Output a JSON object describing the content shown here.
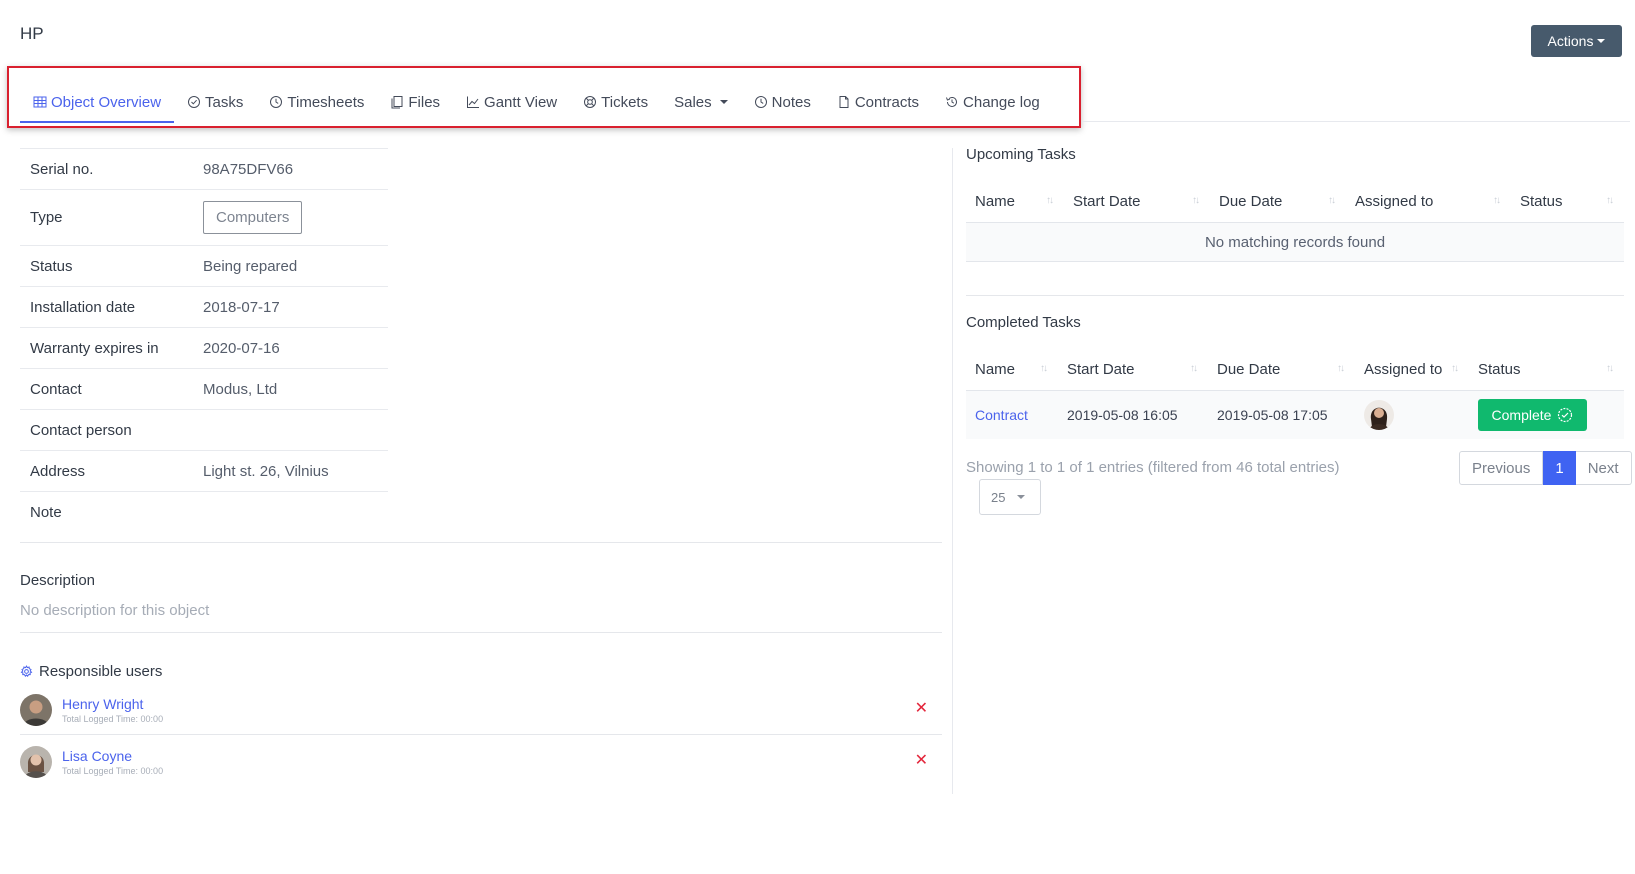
{
  "page": {
    "title": "HP"
  },
  "header": {
    "actions_label": "Actions"
  },
  "tabs": [
    {
      "label": "Object Overview",
      "icon": "grid-icon",
      "active": true
    },
    {
      "label": "Tasks",
      "icon": "check-circle-icon"
    },
    {
      "label": "Timesheets",
      "icon": "clock-icon"
    },
    {
      "label": "Files",
      "icon": "files-icon"
    },
    {
      "label": "Gantt View",
      "icon": "chart-icon"
    },
    {
      "label": "Tickets",
      "icon": "lifebuoy-icon"
    },
    {
      "label": "Sales",
      "icon": "none",
      "dropdown": true
    },
    {
      "label": "Notes",
      "icon": "clock-icon"
    },
    {
      "label": "Contracts",
      "icon": "document-icon"
    },
    {
      "label": "Change log",
      "icon": "history-icon"
    }
  ],
  "info": {
    "rows": [
      {
        "key": "Serial no.",
        "value": "98A75DFV66"
      },
      {
        "key": "Type",
        "value": "Computers"
      },
      {
        "key": "Status",
        "value": "Being repared"
      },
      {
        "key": "Installation date",
        "value": "2018-07-17"
      },
      {
        "key": "Warranty expires in",
        "value": "2020-07-16"
      },
      {
        "key": "Contact",
        "value": "Modus, Ltd"
      },
      {
        "key": "Contact person",
        "value": ""
      },
      {
        "key": "Address",
        "value": "Light st. 26, Vilnius"
      },
      {
        "key": "Note",
        "value": ""
      }
    ]
  },
  "description": {
    "title": "Description",
    "text": "No description for this object"
  },
  "responsible": {
    "title": "Responsible users",
    "users": [
      {
        "name": "Henry Wright",
        "sub": "Total Logged Time: 00:00"
      },
      {
        "name": "Lisa Coyne",
        "sub": "Total Logged Time: 00:00"
      }
    ],
    "remove_symbol": "✕"
  },
  "upcoming": {
    "title": "Upcoming Tasks",
    "columns": [
      "Name",
      "Start Date",
      "Due Date",
      "Assigned to",
      "Status"
    ],
    "empty_text": "No matching records found"
  },
  "completed": {
    "title": "Completed Tasks",
    "columns": [
      "Name",
      "Start Date",
      "Due Date",
      "Assigned to",
      "Status"
    ],
    "rows": [
      {
        "name": "Contract",
        "start": "2019-05-08 16:05",
        "due": "2019-05-08 17:05",
        "status": "Complete"
      }
    ],
    "showing": "Showing 1 to 1 of 1 entries (filtered from 46 total entries)",
    "pager": {
      "previous": "Previous",
      "page": "1",
      "next": "Next"
    },
    "per_page": "25"
  },
  "colors": {
    "accent": "#4b63ec",
    "success": "#10b96e",
    "danger": "#e3263b",
    "highlight": "#d9202f"
  }
}
